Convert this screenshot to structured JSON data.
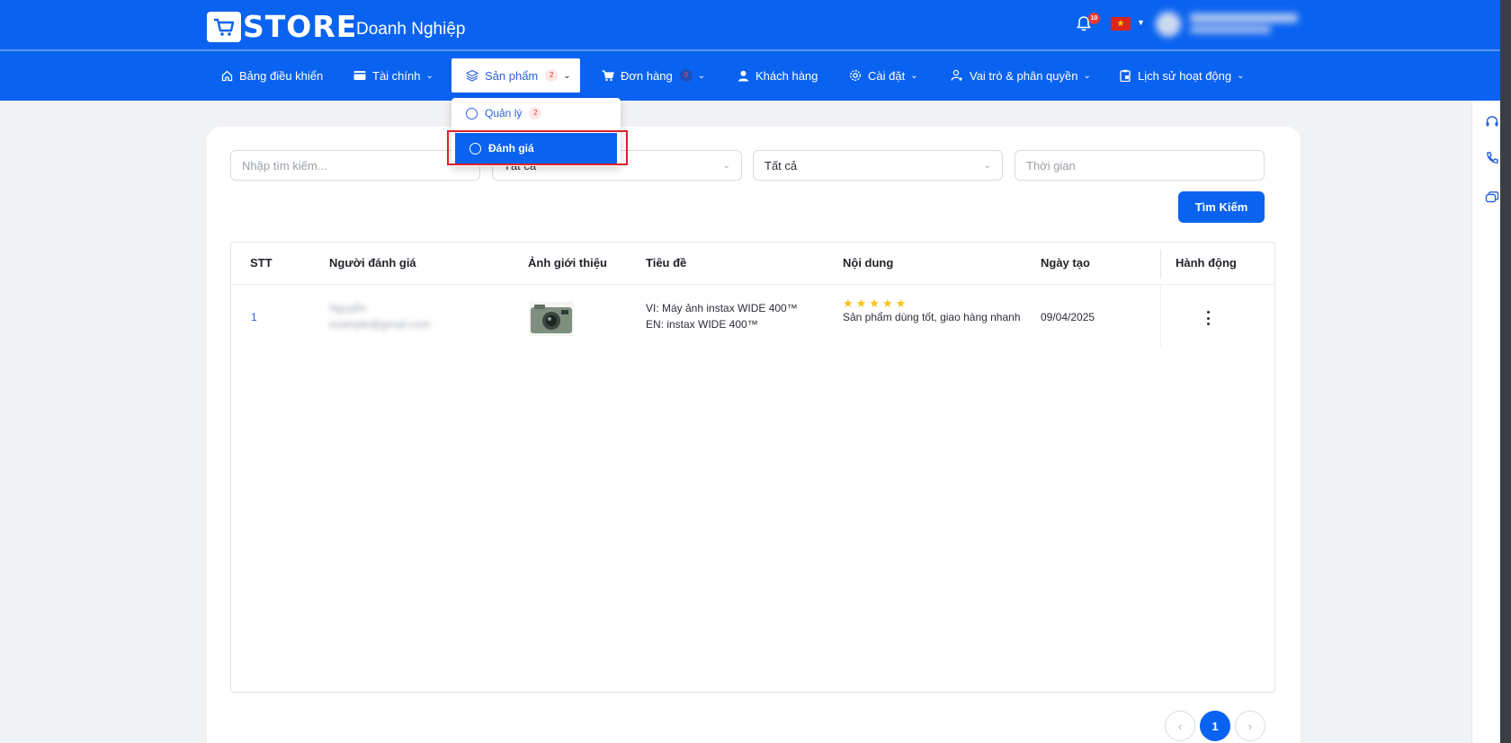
{
  "header": {
    "logo_text": "STORE",
    "brand_sub": "Doanh Nghiệp",
    "notification_count": "10",
    "flag_star": "★"
  },
  "nav": {
    "items": [
      {
        "label": "Bảng điều khiển",
        "icon": "home-icon"
      },
      {
        "label": "Tài chính",
        "icon": "wallet-icon",
        "has_chevron": true
      },
      {
        "label": "Sản phẩm",
        "icon": "layers-icon",
        "badge": "2",
        "has_chevron": true,
        "active": true
      },
      {
        "label": "Đơn hàng",
        "icon": "cart-icon",
        "badge": "0",
        "has_chevron": true
      },
      {
        "label": "Khách hàng",
        "icon": "user-icon"
      },
      {
        "label": "Cài đặt",
        "icon": "gear-icon",
        "has_chevron": true
      },
      {
        "label": "Vai trò & phân quyền",
        "icon": "user-key-icon",
        "has_chevron": true
      },
      {
        "label": "Lịch sử hoạt động",
        "icon": "clipboard-icon",
        "has_chevron": true
      }
    ]
  },
  "dropdown": {
    "items": [
      {
        "label": "Quản lý",
        "badge": "2"
      },
      {
        "label": "Đánh giá",
        "highlighted": true
      }
    ]
  },
  "filters": {
    "search_placeholder": "Nhập tìm kiếm...",
    "select1_value": "Tất cả",
    "select2_value": "Tất cả",
    "time_placeholder": "Thời gian",
    "search_button": "Tìm Kiếm"
  },
  "table": {
    "headers": [
      "STT",
      "Người đánh giá",
      "Ảnh giới thiệu",
      "Tiêu đề",
      "Nội dung",
      "Ngày tạo",
      "Hành động"
    ],
    "rows": [
      {
        "stt": "1",
        "reviewer_name": "Nguyễn",
        "reviewer_email": "example@gmail.com",
        "title_vi": "VI: Máy ảnh instax WIDE 400™",
        "title_en": "EN: instax WIDE 400™",
        "rating": "★★★★★",
        "content": "Sản phẩm dùng tốt, giao hàng nhanh",
        "created": "09/04/2025"
      }
    ]
  },
  "pagination": {
    "prev": "‹",
    "current": "1",
    "next": "›"
  },
  "colors": {
    "primary": "#0a63f0",
    "highlight_box": "#e0202a",
    "star": "#f5c518"
  }
}
